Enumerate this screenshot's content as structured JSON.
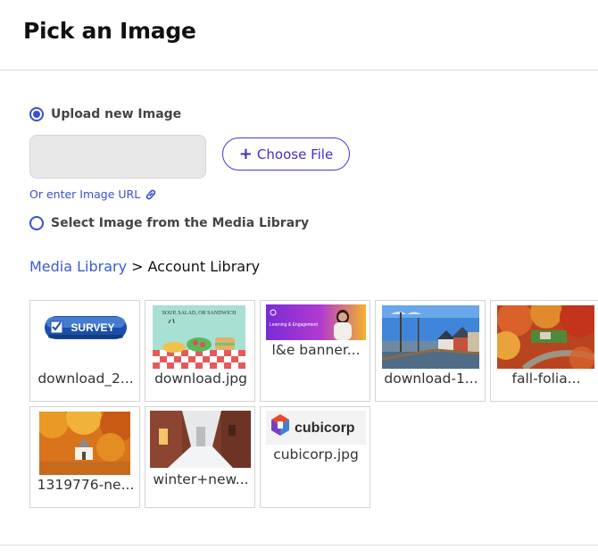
{
  "dialog": {
    "title": "Pick an Image"
  },
  "upload": {
    "radio_label": "Upload new Image",
    "choose_label": "Choose File",
    "url_link_label": "Or enter Image URL"
  },
  "library": {
    "radio_label": "Select Image from the Media Library"
  },
  "breadcrumb": {
    "root": "Media Library",
    "separator": ">",
    "current": "Account Library"
  },
  "images": [
    {
      "name": "download_2...",
      "thumb": "survey-badge"
    },
    {
      "name": "download.jpg",
      "thumb": "soup-salad-sandwich"
    },
    {
      "name": "l&e banner...",
      "thumb": "learning-engagement-banner",
      "thumb_text": "Learning & Engagement"
    },
    {
      "name": "download-1...",
      "thumb": "harbor-town"
    },
    {
      "name": "fall-folia...",
      "thumb": "fall-foliage-road"
    },
    {
      "name": "1319776-ne...",
      "thumb": "autumn-church"
    },
    {
      "name": "winter+new...",
      "thumb": "snowy-alley"
    },
    {
      "name": "cubicorp.jpg",
      "thumb": "cubicorp-logo",
      "thumb_text": "cubicorp"
    }
  ],
  "thumb_texts": {
    "survey": "SURVEY",
    "soup": "SOUP, SALAD, OR SANDWICH"
  },
  "colors": {
    "accent": "#3b4fcf",
    "button_border": "#5b2ed8"
  }
}
